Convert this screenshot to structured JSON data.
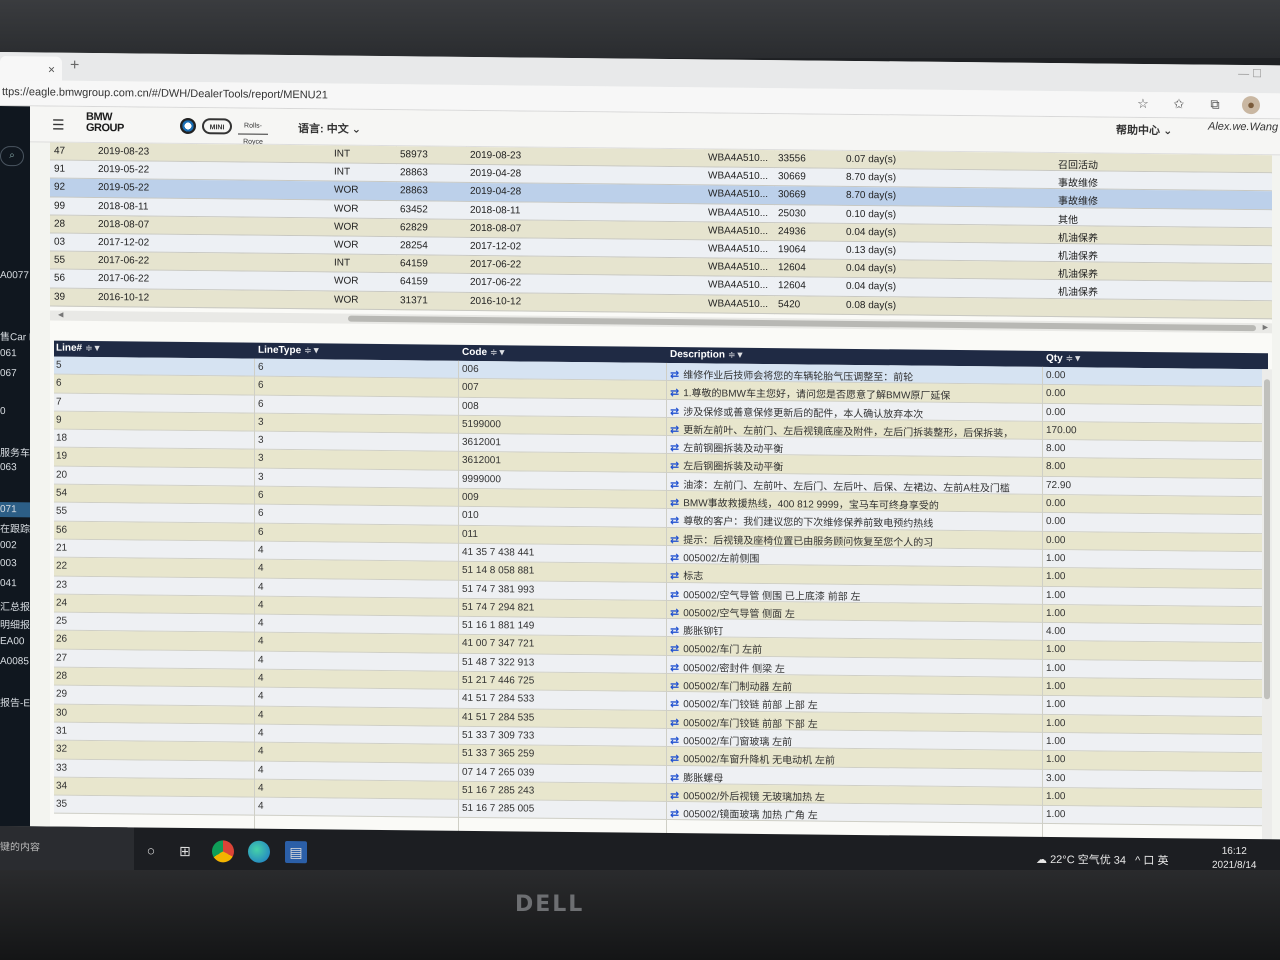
{
  "browser": {
    "tab_close": "×",
    "new_tab": "+",
    "window_controls": "—  ☐",
    "url": "ttps://eagle.bmwgroup.com.cn/#/DWH/DealerTools/report/MENU21"
  },
  "header": {
    "logo_line1": "BMW",
    "logo_line2": "GROUP",
    "brand_mini": "MINI",
    "brand_rr": "Rolls-Royce",
    "language": "语言: 中文",
    "language_caret": "⌄",
    "help": "帮助中心",
    "help_caret": "⌄",
    "user": "Alex.we.Wang"
  },
  "sidebar": {
    "search_icon": "⌕",
    "items": [
      {
        "label": "A0077",
        "active": false
      },
      {
        "label": "售Car F",
        "active": false
      },
      {
        "label": "061",
        "active": false
      },
      {
        "label": "067",
        "active": false
      },
      {
        "label": "0",
        "active": false
      },
      {
        "label": "服务车",
        "active": false
      },
      {
        "label": "063",
        "active": false
      },
      {
        "label": "071",
        "active": true
      },
      {
        "label": "在跟踪",
        "active": false
      },
      {
        "label": "002",
        "active": false
      },
      {
        "label": "003",
        "active": false
      },
      {
        "label": "041",
        "active": false
      },
      {
        "label": "汇总报",
        "active": false
      },
      {
        "label": "明细报",
        "active": false
      },
      {
        "label": "EA00",
        "active": false
      },
      {
        "label": "A0085",
        "active": false
      },
      {
        "label": "报告-E",
        "active": false
      }
    ]
  },
  "upper_table": {
    "rows": [
      [
        "47",
        "2019-08-23",
        "INT",
        "58973",
        "2019-08-23",
        "WBA4A510...",
        "33556",
        "0.07 day(s)",
        "召回活动"
      ],
      [
        "91",
        "2019-05-22",
        "INT",
        "28863",
        "2019-04-28",
        "WBA4A510...",
        "30669",
        "8.70 day(s)",
        "事故维修"
      ],
      [
        "92",
        "2019-05-22",
        "WOR",
        "28863",
        "2019-04-28",
        "WBA4A510...",
        "30669",
        "8.70 day(s)",
        "事故维修"
      ],
      [
        "99",
        "2018-08-11",
        "WOR",
        "63452",
        "2018-08-11",
        "WBA4A510...",
        "25030",
        "0.10 day(s)",
        "其他"
      ],
      [
        "28",
        "2018-08-07",
        "WOR",
        "62829",
        "2018-08-07",
        "WBA4A510...",
        "24936",
        "0.04 day(s)",
        "机油保养"
      ],
      [
        "03",
        "2017-12-02",
        "WOR",
        "28254",
        "2017-12-02",
        "WBA4A510...",
        "19064",
        "0.13 day(s)",
        "机油保养"
      ],
      [
        "55",
        "2017-06-22",
        "INT",
        "64159",
        "2017-06-22",
        "WBA4A510...",
        "12604",
        "0.04 day(s)",
        "机油保养"
      ],
      [
        "56",
        "2017-06-22",
        "WOR",
        "64159",
        "2017-06-22",
        "WBA4A510...",
        "12604",
        "0.04 day(s)",
        "机油保养"
      ],
      [
        "39",
        "2016-10-12",
        "WOR",
        "31371",
        "2016-10-12",
        "WBA4A510...",
        "5420",
        "0.08 day(s)",
        ""
      ]
    ],
    "selected_row": 2
  },
  "lower_table": {
    "columns": [
      "Line#",
      "LineType",
      "Code",
      "Description",
      "Qty"
    ],
    "sort_icon": "≑▼",
    "link_icon": "⇄",
    "rows": [
      [
        "5",
        "6",
        "006",
        "维修作业后技师会将您的车辆轮胎气压调整至：前轮",
        "0.00"
      ],
      [
        "6",
        "6",
        "007",
        "1.尊敬的BMW车主您好，请问您是否愿意了解BMW原厂延保",
        "0.00"
      ],
      [
        "7",
        "6",
        "008",
        "涉及保修或善意保修更新后的配件，本人确认放弃本次",
        "0.00"
      ],
      [
        "9",
        "3",
        "5199000",
        "更新左前叶、左前门、左后视镜底座及附件，左后门拆装整形，后保拆装，",
        "170.00"
      ],
      [
        "18",
        "3",
        "3612001",
        "左前钢圈拆装及动平衡",
        "8.00"
      ],
      [
        "19",
        "3",
        "3612001",
        "左后钢圈拆装及动平衡",
        "8.00"
      ],
      [
        "20",
        "3",
        "9999000",
        "油漆：左前门、左前叶、左后门、左后叶、后保、左裙边、左前A柱及门槛",
        "72.90"
      ],
      [
        "54",
        "6",
        "009",
        "BMW事故救援热线，400 812 9999，宝马车可终身享受的",
        "0.00"
      ],
      [
        "55",
        "6",
        "010",
        "尊敬的客户：我们建议您的下次维修保养前致电预约热线",
        "0.00"
      ],
      [
        "56",
        "6",
        "011",
        "提示：后视镜及座椅位置已由服务顾问恢复至您个人的习",
        "0.00"
      ],
      [
        "21",
        "4",
        "41 35 7 438 441",
        "005002/左前侧围",
        "1.00"
      ],
      [
        "22",
        "4",
        "51 14 8 058 881",
        "标志",
        "1.00"
      ],
      [
        "23",
        "4",
        "51 74 7 381 993",
        "005002/空气导管 侧围 已上底漆 前部 左",
        "1.00"
      ],
      [
        "24",
        "4",
        "51 74 7 294 821",
        "005002/空气导管 侧面 左",
        "1.00"
      ],
      [
        "25",
        "4",
        "51 16 1 881 149",
        "膨胀铆钉",
        "4.00"
      ],
      [
        "26",
        "4",
        "41 00 7 347 721",
        "005002/车门 左前",
        "1.00"
      ],
      [
        "27",
        "4",
        "51 48 7 322 913",
        "005002/密封件 侧梁 左",
        "1.00"
      ],
      [
        "28",
        "4",
        "51 21 7 446 725",
        "005002/车门制动器 左前",
        "1.00"
      ],
      [
        "29",
        "4",
        "41 51 7 284 533",
        "005002/车门铰链 前部 上部 左",
        "1.00"
      ],
      [
        "30",
        "4",
        "41 51 7 284 535",
        "005002/车门铰链 前部 下部 左",
        "1.00"
      ],
      [
        "31",
        "4",
        "51 33 7 309 733",
        "005002/车门窗玻璃 左前",
        "1.00"
      ],
      [
        "32",
        "4",
        "51 33 7 365 259",
        "005002/车窗升降机 无电动机 左前",
        "1.00"
      ],
      [
        "33",
        "4",
        "07 14 7 265 039",
        "膨胀螺母",
        "3.00"
      ],
      [
        "34",
        "4",
        "51 16 7 285 243",
        "005002/外后视镜 无玻璃加热 左",
        "1.00"
      ],
      [
        "35",
        "4",
        "51 16 7 285 005",
        "005002/镜面玻璃 加热 广角 左",
        "1.00"
      ]
    ]
  },
  "taskbar": {
    "search_text": "键的内容",
    "icons": [
      "○",
      "⊞",
      "",
      "",
      "▤"
    ],
    "weather": "22°C 空气优 34",
    "tray": "^ 口 英",
    "time": "16:12",
    "date": "2021/8/14"
  },
  "monitor": {
    "brand": "DELL"
  }
}
